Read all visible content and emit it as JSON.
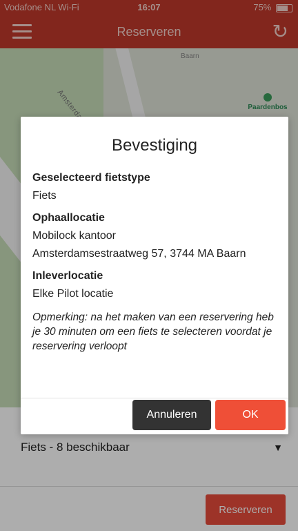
{
  "status_bar": {
    "carrier": "Vodafone NL Wi-Fi",
    "time": "16:07",
    "battery": "75%",
    "battery_level": 0.75
  },
  "header": {
    "title": "Reserveren",
    "menu_icon": "hamburger-icon",
    "refresh_icon": "refresh-icon"
  },
  "map": {
    "street": "Amsterdamsestraatweg",
    "town": "Baarn",
    "poi": "Paardenbos"
  },
  "panel": {
    "selection": "Fiets - 8 beschikbaar",
    "reserve_label": "Reserveren"
  },
  "modal": {
    "title": "Bevestiging",
    "bike_type_heading": "Geselecteerd fietstype",
    "bike_type_value": "Fiets",
    "pickup_heading": "Ophaallocatie",
    "pickup_name": "Mobilock kantoor",
    "pickup_address": "Amsterdamsestraatweg 57, 3744 MA Baarn",
    "dropoff_heading": "Inleverlocatie",
    "dropoff_value": "Elke Pilot locatie",
    "note": "Opmerking: na het maken van een reservering heb je 30 minuten om een fiets te selecteren voordat je reservering verloopt",
    "cancel_label": "Annuleren",
    "ok_label": "OK"
  },
  "colors": {
    "brand": "#c0392b",
    "ok_button": "#ef4f37",
    "cancel_button": "#333333"
  }
}
